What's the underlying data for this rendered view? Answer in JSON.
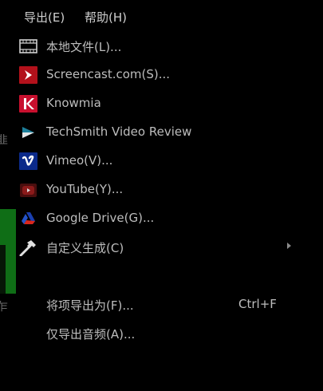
{
  "menubar": {
    "edge_fragment": ")",
    "export_label": "导出(E)",
    "help_label": "帮助(H)"
  },
  "left_edge": {
    "char_1": "韭",
    "char_2": "乍"
  },
  "export_menu": {
    "items": [
      {
        "label": "本地文件(L)...",
        "icon": "film-icon"
      },
      {
        "label": "Screencast.com(S)...",
        "icon": "screencast-icon",
        "color": "#b3111b"
      },
      {
        "label": "Knowmia",
        "icon": "knowmia-icon",
        "color": "#c8102e"
      },
      {
        "label": "TechSmith Video Review",
        "icon": "video-review-icon"
      },
      {
        "label": "Vimeo(V)...",
        "icon": "vimeo-icon",
        "color": "#0b2a8a"
      },
      {
        "label": "YouTube(Y)...",
        "icon": "youtube-icon",
        "color": "#8b1a1a"
      },
      {
        "label": "Google Drive(G)...",
        "icon": "google-drive-icon"
      },
      {
        "label": "自定义生成(C)",
        "icon": "hammer-icon",
        "has_submenu": true
      },
      {
        "label": "将项导出为(F)...",
        "shortcut": "Ctrl+F"
      },
      {
        "label": "仅导出音频(A)..."
      }
    ]
  }
}
